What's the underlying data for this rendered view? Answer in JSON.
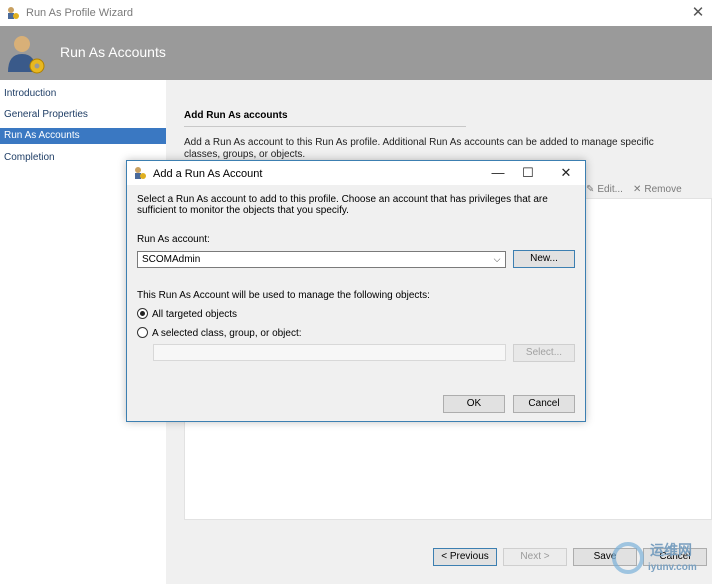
{
  "window": {
    "title": "Run As Profile Wizard",
    "close_glyph": "✕"
  },
  "header": {
    "title": "Run As Accounts"
  },
  "nav": {
    "items": [
      {
        "label": "Introduction"
      },
      {
        "label": "General Properties"
      },
      {
        "label": "Run As Accounts"
      },
      {
        "label": "Completion"
      }
    ],
    "selected_index": 2
  },
  "content": {
    "section_title": "Add Run As accounts",
    "description": "Add a Run As account to this Run As profile.  Additional Run As accounts can be added to manage specific classes, groups, or objects.",
    "toolbar": {
      "edit_label": "Edit...",
      "remove_label": "Remove"
    }
  },
  "footer": {
    "previous_label": "< Previous",
    "next_label": "Next >",
    "save_label": "Save",
    "cancel_label": "Cancel"
  },
  "dialog": {
    "title": "Add a Run As Account",
    "minimize_glyph": "—",
    "maximize_glyph": "☐",
    "close_glyph": "✕",
    "description": "Select a Run As account to add to this profile.  Choose an account that has privileges that are sufficient to monitor the objects that you specify.",
    "account_label": "Run As account:",
    "account_value": "SCOMAdmin",
    "new_button": "New...",
    "manage_text": "This Run As Account will be used to manage the following objects:",
    "radio_all": "All targeted objects",
    "radio_selected": "A selected class, group, or object:",
    "selected_option": "all",
    "select_button": "Select...",
    "ok_button": "OK",
    "cancel_button": "Cancel"
  },
  "watermark": {
    "text": "运维网",
    "subtext": "iyunv.com"
  },
  "colors": {
    "header_bg": "#9a9a9a",
    "nav_selected": "#3a78c2",
    "dialog_border": "#3c7fb1"
  }
}
